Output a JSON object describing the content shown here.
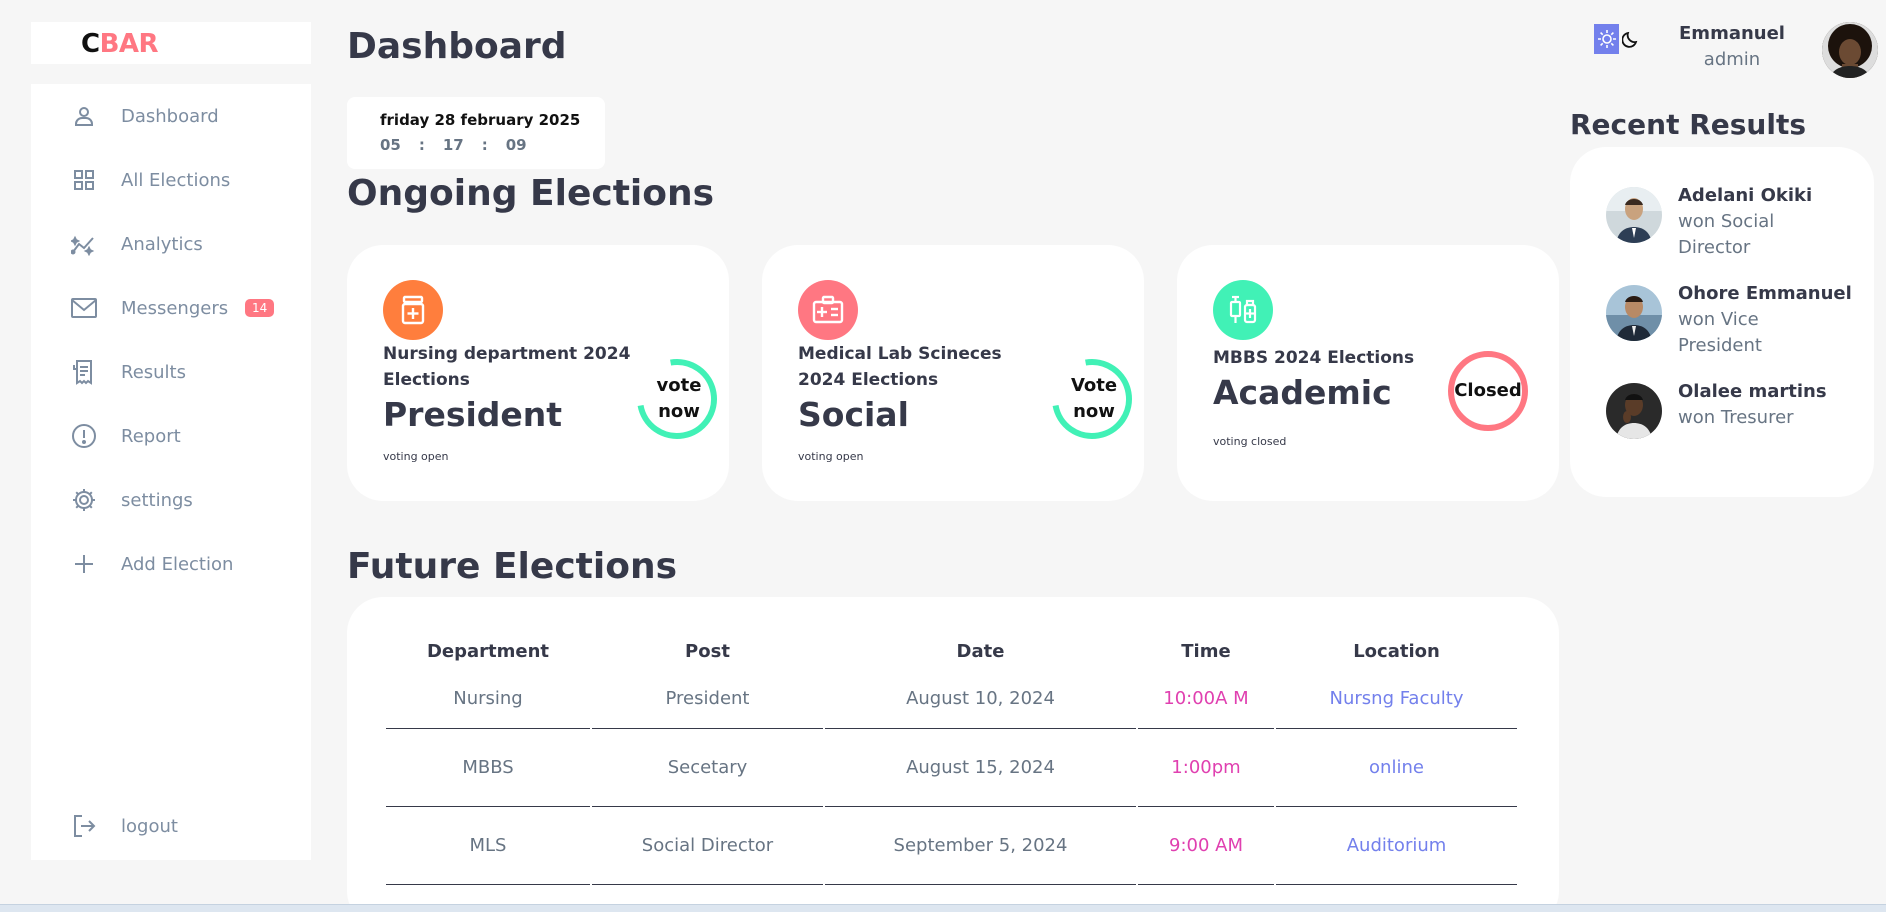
{
  "brand": {
    "c": "C",
    "bar": "BAR"
  },
  "sidebar": {
    "items": [
      {
        "label": "Dashboard",
        "icon": "user-icon"
      },
      {
        "label": "All Elections",
        "icon": "grid-icon"
      },
      {
        "label": "Analytics",
        "icon": "analytics-icon"
      },
      {
        "label": "Messengers",
        "icon": "mail-icon",
        "badge": "14"
      },
      {
        "label": "Results",
        "icon": "receipt-icon"
      },
      {
        "label": "Report",
        "icon": "report-icon"
      },
      {
        "label": "settings",
        "icon": "gear-icon"
      },
      {
        "label": "Add Election",
        "icon": "plus-icon"
      }
    ],
    "logout": {
      "label": "logout",
      "icon": "logout-icon"
    }
  },
  "header": {
    "title": "Dashboard",
    "date": "friday 28 february 2025",
    "time": {
      "h": "05",
      "sep1": ":",
      "m": "17",
      "sep2": ":",
      "s": "09"
    },
    "profile": {
      "name": "Emmanuel",
      "role": "admin"
    }
  },
  "ongoing": {
    "title": "Ongoing Elections",
    "cards": [
      {
        "dept": "Nursing department 2024 Elections",
        "post": "President",
        "status": "voting open",
        "button": "vote now",
        "icon": "medicine-bottle-icon",
        "color": "#ff7e3d",
        "ring_color": "#41f1b6",
        "progress": 0.75
      },
      {
        "dept": "Medical Lab Scineces 2024 Elections",
        "post": "Social",
        "status": "voting open",
        "button": "Vote now",
        "icon": "id-badge-icon",
        "color": "#ff7782",
        "ring_color": "#41f1b6",
        "progress": 0.75
      },
      {
        "dept": "MBBS 2024 Elections",
        "post": "Academic",
        "status": "voting closed",
        "button": "Closed",
        "icon": "vaccine-icon",
        "color": "#41f1b6",
        "ring_color": "#ff7782",
        "progress": 1.0
      }
    ]
  },
  "recent": {
    "title": "Recent Results",
    "items": [
      {
        "name": "Adelani Okiki",
        "text": "won Social Director"
      },
      {
        "name": "Ohore Emmanuel",
        "text": "won Vice President"
      },
      {
        "name": "Olalee martins",
        "text": "won Tresurer"
      }
    ]
  },
  "future": {
    "title": "Future Elections",
    "columns": [
      "Department",
      "Post",
      "Date",
      "Time",
      "Location"
    ],
    "rows": [
      [
        "Nursing",
        "President",
        "August 10, 2024",
        "10:00A M",
        "Nursng Faculty"
      ],
      [
        "MBBS",
        "Secetary",
        "August 15, 2024",
        "1:00pm",
        "online"
      ],
      [
        "MLS",
        "Social Director",
        "September 5, 2024",
        "9:00 AM",
        "Auditorium"
      ]
    ]
  },
  "colors": {
    "primary": "#7380ec",
    "danger": "#ff7782",
    "success": "#41f1b6",
    "warning": "#ff7e3d",
    "dark": "#363949",
    "muted": "#7d8da1"
  }
}
